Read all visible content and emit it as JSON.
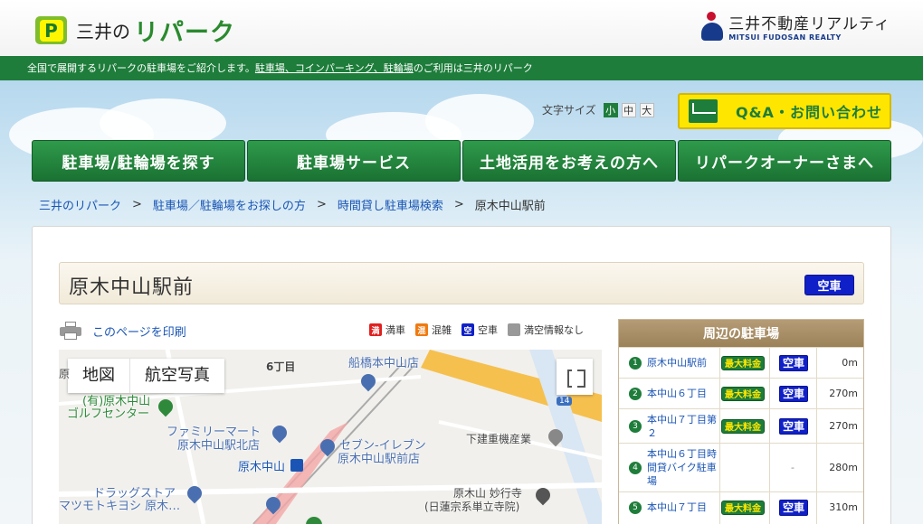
{
  "header": {
    "brand_mitsui": "三井の",
    "brand_repark": "リパーク",
    "realty_jp": "三井不動産リアルティ",
    "realty_en": "MITSUI FUDOSAN REALTY"
  },
  "greenbar": {
    "text_before": "全国で展開するリパークの駐車場をご紹介します。",
    "link_text": "駐車場、コインパーキング、駐輪場",
    "text_after": "のご利用は三井のリパーク"
  },
  "fontsize": {
    "label": "文字サイズ",
    "small": "小",
    "medium": "中",
    "large": "大"
  },
  "qa_button": "Q&A・お問い合わせ",
  "nav": [
    {
      "label": "駐車場/駐輪場を探す"
    },
    {
      "label": "駐車場サービス"
    },
    {
      "label": "土地活用をお考えの方へ"
    },
    {
      "label": "リパークオーナーさまへ"
    }
  ],
  "breadcrumb": {
    "home": "三井のリパーク",
    "level1": "駐車場／駐輪場をお探しの方",
    "level2": "時間貸し駐車場検索",
    "current": "原木中山駅前",
    "separator": ">"
  },
  "page_title": "原木中山駅前",
  "status_badge": "空車",
  "print_label": "このページを印刷",
  "legend": [
    {
      "glyph": "満",
      "label": "満車",
      "color": "#e02020"
    },
    {
      "glyph": "混",
      "label": "混雑",
      "color": "#f07a10"
    },
    {
      "glyph": "空",
      "label": "空車",
      "color": "#1020c8"
    },
    {
      "glyph": "",
      "label": "満空情報なし",
      "color": "#999999"
    }
  ],
  "map": {
    "tab_map": "地図",
    "tab_aerial": "航空写真",
    "labels": {
      "district": "6丁目",
      "shop1": "船橋本中山店",
      "golf1": "(有)原木中山",
      "golf2": "ゴルフセンター",
      "famima1": "ファミリーマート",
      "famima2": "原木中山駅北店",
      "seven1": "セブン-イレブン",
      "seven2": "原木中山駅前店",
      "station": "原木中山",
      "drug1": "ドラッグストア",
      "drug2": "マツモトキヨシ 原木…",
      "shimoden": "下建重機産業",
      "temple1": "原木山 妙行寺",
      "temple2": "(日蓮宗系単立寺院)",
      "route": "14",
      "edge": "原"
    }
  },
  "nearby": {
    "heading": "周辺の駐車場",
    "rows": [
      {
        "num": "1",
        "name": "原木中山駅前",
        "price": "最大料金",
        "status": "空車",
        "dist": "0m"
      },
      {
        "num": "2",
        "name": "本中山６丁目",
        "price": "最大料金",
        "status": "空車",
        "dist": "270m"
      },
      {
        "num": "3",
        "name": "本中山７丁目第２",
        "price": "最大料金",
        "status": "空車",
        "dist": "270m"
      },
      {
        "num": "4",
        "name": "本中山６丁目時間貸バイク駐車場",
        "price": "",
        "status": "-",
        "dist": "280m"
      },
      {
        "num": "5",
        "name": "本中山７丁目",
        "price": "最大料金",
        "status": "空車",
        "dist": "310m"
      }
    ]
  }
}
